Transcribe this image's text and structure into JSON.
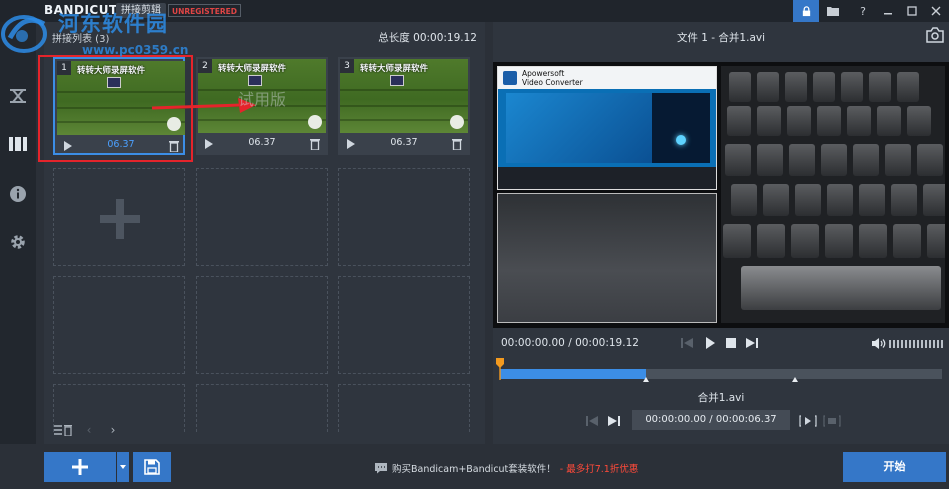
{
  "window": {
    "app_name": "BANDICUT",
    "mode_tab": "拼接剪辑",
    "unregistered_badge": "UNREGISTERED"
  },
  "watermark": {
    "site_name": "河东软件园",
    "site_url": "www.pc0359.cn",
    "trial_text": "试用版"
  },
  "sidebar": {
    "items": [
      {
        "icon": "cut-icon"
      },
      {
        "icon": "film-strip-icon"
      },
      {
        "icon": "info-icon"
      },
      {
        "icon": "gear-icon"
      },
      {
        "icon": "record-icon"
      }
    ]
  },
  "clip_list": {
    "title": "拼接列表 (3)",
    "total_length": "总长度 00:00:19.12",
    "clips": [
      {
        "num": "1",
        "duration": "06.37",
        "caption": "转转大师录屏软件",
        "selected": true
      },
      {
        "num": "2",
        "duration": "06.37",
        "caption": "转转大师录屏软件",
        "selected": false
      },
      {
        "num": "3",
        "duration": "06.37",
        "caption": "转转大师录屏软件",
        "selected": false
      }
    ]
  },
  "preview": {
    "file_title": "文件 1 - 合并1.avi",
    "time_display": "00:00:00.00 / 00:00:19.12",
    "app_title_line1": "Apowersoft",
    "app_title_line2": "Video Converter",
    "timeline": {
      "progress_fraction": 0.33,
      "segment_marks": [
        0.33,
        0.667
      ]
    },
    "segment_name": "合并1.avi",
    "segment_time": "00:00:00.00 / 00:00:06.37"
  },
  "bottom": {
    "promo_text": "购买Bandicam+Bandicut套装软件！",
    "promo_highlight": "- 最多打7.1折优惠",
    "start_label": "开始"
  },
  "colors": {
    "accent": "#3577c8",
    "highlight": "#e5242b",
    "selected": "#3c8ee6"
  }
}
